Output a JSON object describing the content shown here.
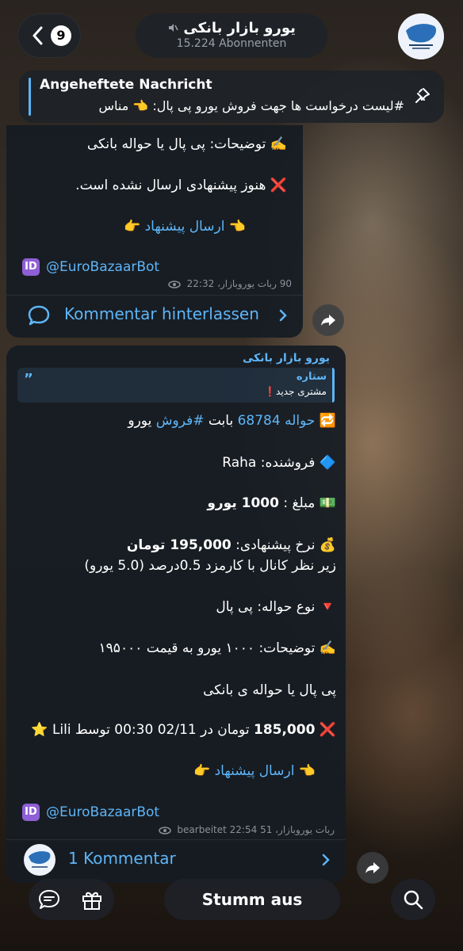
{
  "header": {
    "back_count": "9",
    "channel_name": "یورو بازار بانکی",
    "subscribers": "15.224 Abonnenten"
  },
  "pinned": {
    "label": "Angeheftete Nachricht",
    "text": "#لیست درخواست ها جهت فروش یورو پی پال: 👈 مناس"
  },
  "message1": {
    "desc": "توضیحات: پی پال یا حواله بانکی",
    "desc_emoji": "✍️",
    "no_offer": "هنوز پیشنهادی ارسال نشده است.",
    "no_offer_emoji": "❌",
    "send_offer": "ارسال پیشنهاد",
    "bot": "@EuroBazaarBot",
    "meta_author": "90 ربات یوروبازار،",
    "meta_time": "22:32",
    "comment_label": "Kommentar hinterlassen"
  },
  "message2": {
    "sender": "یورو بازار بانکی",
    "quote_name": "ستاره",
    "quote_text": "مشتری جدید❗️",
    "title_prefix": "حواله",
    "title_number": "68784",
    "title_mid": "بابت",
    "title_tag": "#فروش",
    "title_suffix": "یورو",
    "seller": "فروشنده: Raha",
    "amount_label": "مبلغ :",
    "amount_value": "1000 یورو",
    "rate_label": "نرخ پیشنهادی:",
    "rate_value": "195,000 تومان",
    "fee_line": "زیر نظر کانال با کارمزد 0.5درصد (5.0 یورو)",
    "transfer_type": "نوع حواله: پی پال",
    "desc": "توضیحات: ۱۰۰۰ یورو به قیمت ۱۹۵۰۰۰",
    "desc2": "پی پال یا حواله ی بانکی",
    "offer_amount": "185,000",
    "offer_rest": "تومان در 02/11 00:30 توسط Lili",
    "send_offer": "ارسال پیشنهاد",
    "bot": "@EuroBazaarBot",
    "meta_author": "ربات یوروبازار،",
    "meta_views": "51",
    "meta_time": "bearbeitet 22:54",
    "comment_label": "1 Kommentar"
  },
  "bottom": {
    "mute_label": "Stumm aus"
  },
  "icons": {
    "back": "chevron-left-icon",
    "mute": "muted-speaker-icon",
    "pin": "pin-icon",
    "eye": "eye-icon",
    "comment": "comment-bubble-icon",
    "chevron": "chevron-right-icon",
    "share": "share-arrow-icon",
    "chat": "chat-icon",
    "gift": "gift-icon",
    "search": "search-icon"
  },
  "colors": {
    "accent": "#5eb5f7",
    "bubble": "#161c24"
  }
}
